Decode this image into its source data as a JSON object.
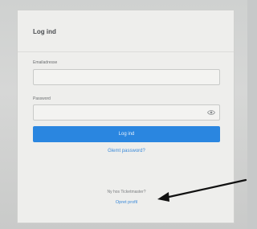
{
  "login": {
    "title": "Log ind",
    "email_label": "Emailadresse",
    "email_value": "",
    "password_label": "Password",
    "password_value": "",
    "submit_label": "Log ind",
    "forgot_link": "Glemt password?",
    "signup_prompt": "Ny hos Ticketmaster?",
    "signup_link": "Opret profil"
  },
  "colors": {
    "accent": "#2a86e0",
    "link": "#3a89d8"
  },
  "icons": {
    "password_toggle": "eye-icon",
    "annotation": "arrow-icon"
  }
}
